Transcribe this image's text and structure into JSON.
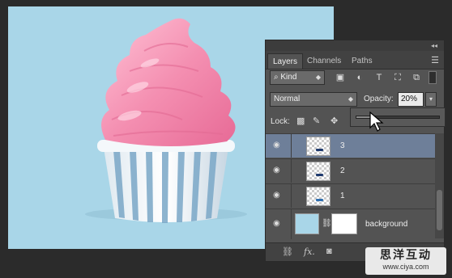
{
  "panel": {
    "collapse_glyph": "◂◂",
    "tabs": [
      {
        "label": "Layers",
        "active": true
      },
      {
        "label": "Channels",
        "active": false
      },
      {
        "label": "Paths",
        "active": false
      }
    ],
    "filter": {
      "kind_label": "Kind"
    },
    "blend_mode": "Normal",
    "opacity_label": "Opacity:",
    "opacity_value": "20%",
    "lock_label": "Lock:",
    "layers": [
      {
        "name": "3",
        "selected": true
      },
      {
        "name": "2",
        "selected": false
      },
      {
        "name": "1",
        "selected": false
      },
      {
        "name": "background",
        "selected": false
      }
    ],
    "bottom_icons": [
      "link-icon",
      "fx-icon",
      "mask-icon"
    ],
    "bottom_fx_label": "fx."
  },
  "opacity_slider": {
    "value_fraction": 0.2
  },
  "watermark": {
    "title": "思洋互动",
    "url": "www.ciya.com"
  },
  "colors": {
    "canvas_bg": "#a9d6e8",
    "frosting": "#f48fb1",
    "cup_stripe": "#6f9fbf",
    "selected_layer": "#6e7f99"
  }
}
